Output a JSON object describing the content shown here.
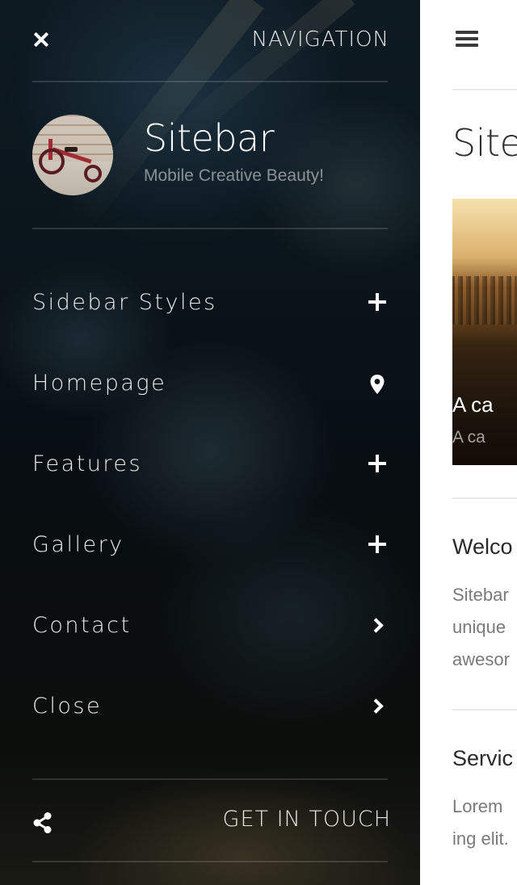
{
  "sidebar": {
    "heading": "NAVIGATION",
    "profile": {
      "title": "Sitebar",
      "subtitle": "Mobile Creative Beauty!"
    },
    "items": [
      {
        "label": "Sidebar Styles",
        "icon": "plus-icon"
      },
      {
        "label": "Homepage",
        "icon": "map-pin-icon"
      },
      {
        "label": "Features",
        "icon": "plus-icon"
      },
      {
        "label": "Gallery",
        "icon": "plus-icon"
      },
      {
        "label": "Contact",
        "icon": "chevron-right-icon"
      },
      {
        "label": "Close",
        "icon": "chevron-right-icon"
      }
    ],
    "footer": {
      "link_label": "GET IN TOUCH",
      "icon": "share-icon"
    }
  },
  "page": {
    "title": "Site",
    "hero": {
      "caption": "A ca",
      "subcaption": "A ca"
    },
    "sections": [
      {
        "title": "Welco",
        "lines": [
          "Sitebar",
          "unique",
          "awesor"
        ]
      },
      {
        "title": "Servic",
        "lines": [
          "Lorem",
          "ing elit."
        ]
      }
    ]
  },
  "colors": {
    "sidebar_bg": "#0a141b",
    "text_light": "#ffffff",
    "page_bg": "#ffffff",
    "page_text": "#7a7a7a"
  }
}
